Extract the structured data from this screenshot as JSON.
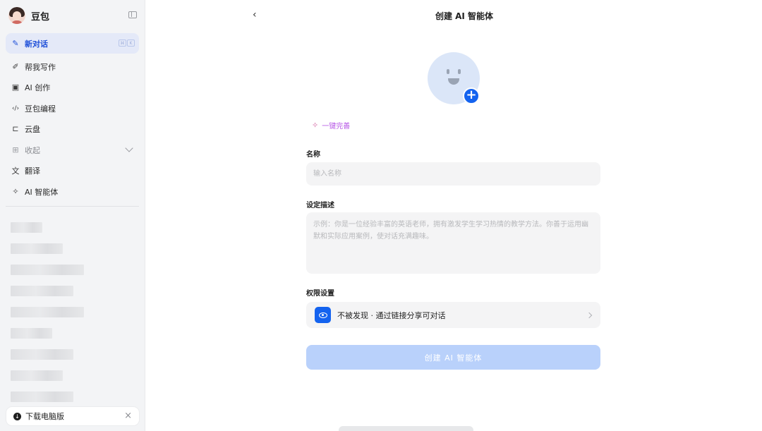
{
  "sidebar": {
    "app_name": "豆包",
    "new_chat": {
      "label": "新对话",
      "shortcut": [
        "⌘",
        "K"
      ]
    },
    "items": [
      {
        "label": "帮我写作",
        "icon": "pen-sparkle-icon"
      },
      {
        "label": "AI 创作",
        "icon": "image-create-icon"
      },
      {
        "label": "豆包编程",
        "icon": "code-icon"
      },
      {
        "label": "云盘",
        "icon": "cloud-folder-icon"
      },
      {
        "label": "收起",
        "icon": "apps-icon"
      },
      {
        "label": "翻译",
        "icon": "translate-icon"
      },
      {
        "label": "AI 智能体",
        "icon": "sparkle-icon"
      }
    ],
    "download": {
      "label": "下载电脑版"
    }
  },
  "header": {
    "title": "创建 AI 智能体"
  },
  "form": {
    "magic_label": "一键完善",
    "name_label": "名称",
    "name_placeholder": "输入名称",
    "desc_label": "设定描述",
    "desc_placeholder": "示例：你是一位经验丰富的英语老师，拥有激发学生学习热情的教学方法。你善于运用幽默和实际应用案例，使对话充满趣味。",
    "perm_label": "权限设置",
    "perm_value": "不被发现 · 通过链接分享可对话",
    "create_button": "创建 AI 智能体"
  },
  "colors": {
    "accent": "#1463ef",
    "active_nav_bg": "#e4e9f8",
    "disabled_button": "#b9d1fb",
    "magic_text": "#b657e6"
  }
}
